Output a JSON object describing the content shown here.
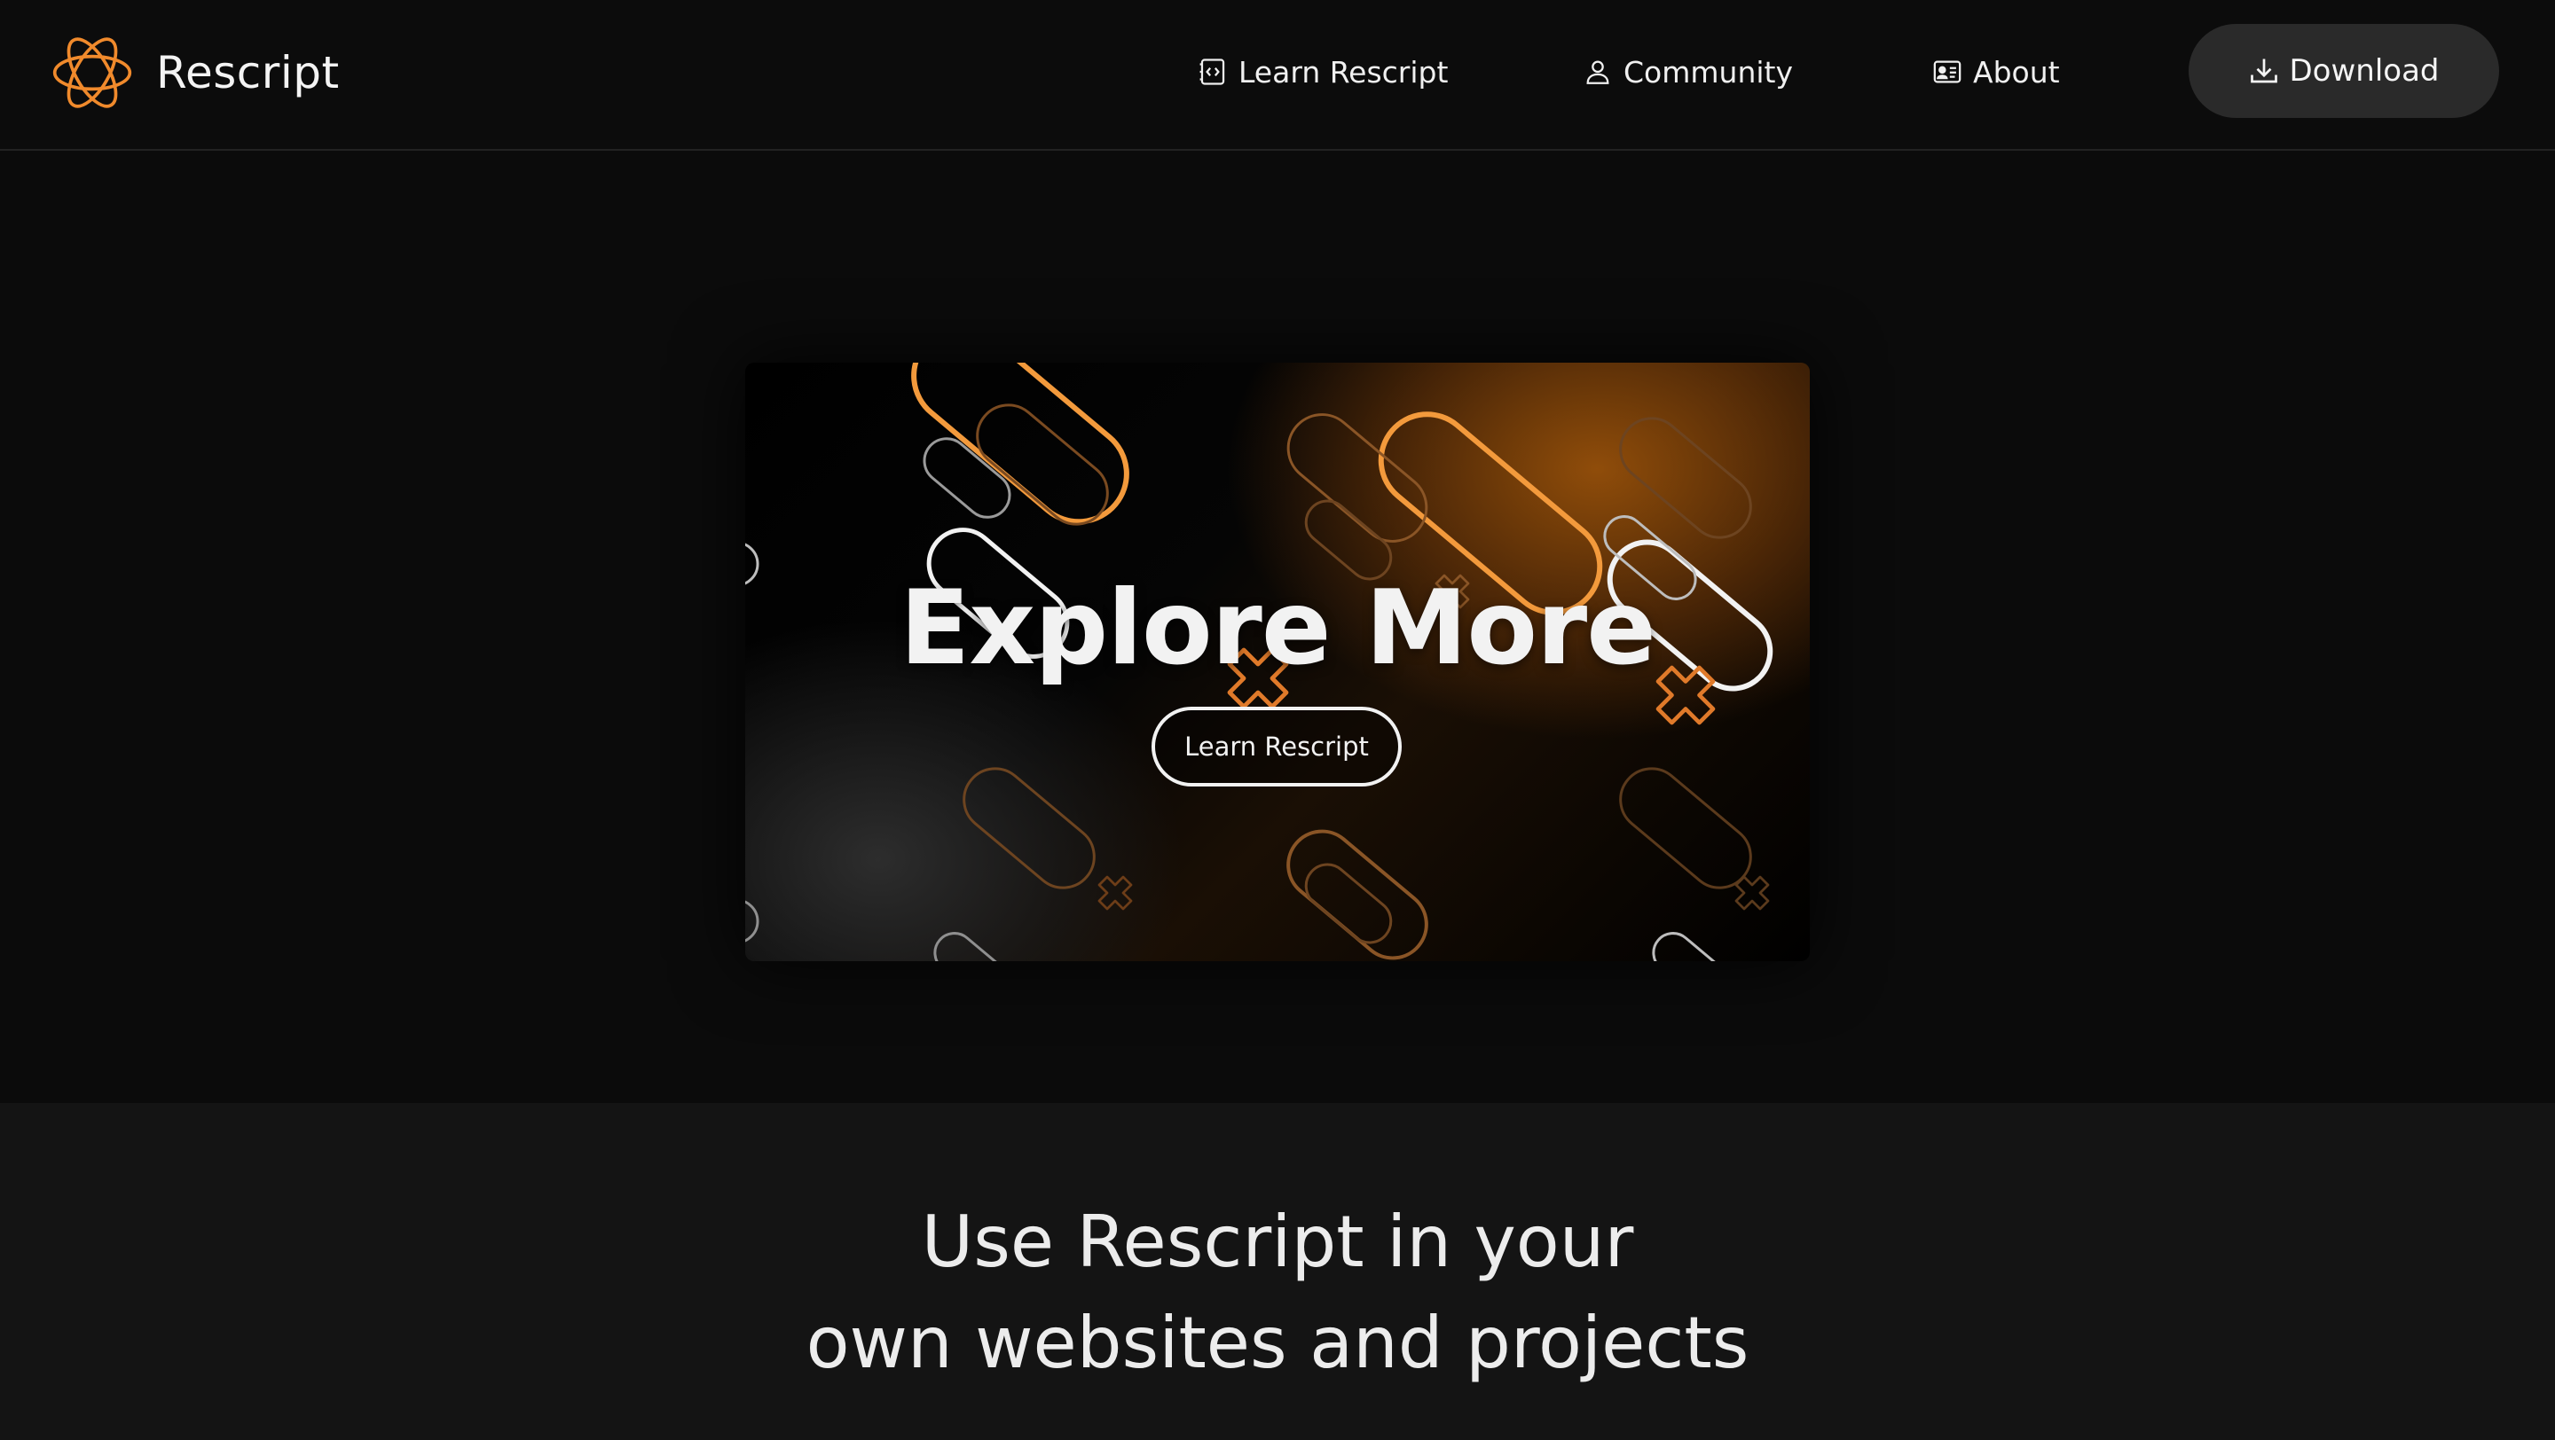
{
  "nav": {
    "brand_name": "Rescript",
    "links": [
      {
        "label": "Learn Rescript",
        "icon": "code-file-icon"
      },
      {
        "label": "Community",
        "icon": "user-icon"
      },
      {
        "label": "About",
        "icon": "id-card-icon"
      }
    ],
    "download_label": "Download",
    "download_icon": "download-icon",
    "logo_icon": "atom-logo-icon"
  },
  "hero": {
    "title": "Explore More",
    "button_label": "Learn Rescript"
  },
  "use_section": {
    "line1": "Use Rescript in your",
    "line2": "own websites and projects"
  },
  "colors": {
    "background": "#0b0b0b",
    "accent": "#f08a2c",
    "download_bg": "#2a2a2a",
    "section_bg": "#141414"
  }
}
